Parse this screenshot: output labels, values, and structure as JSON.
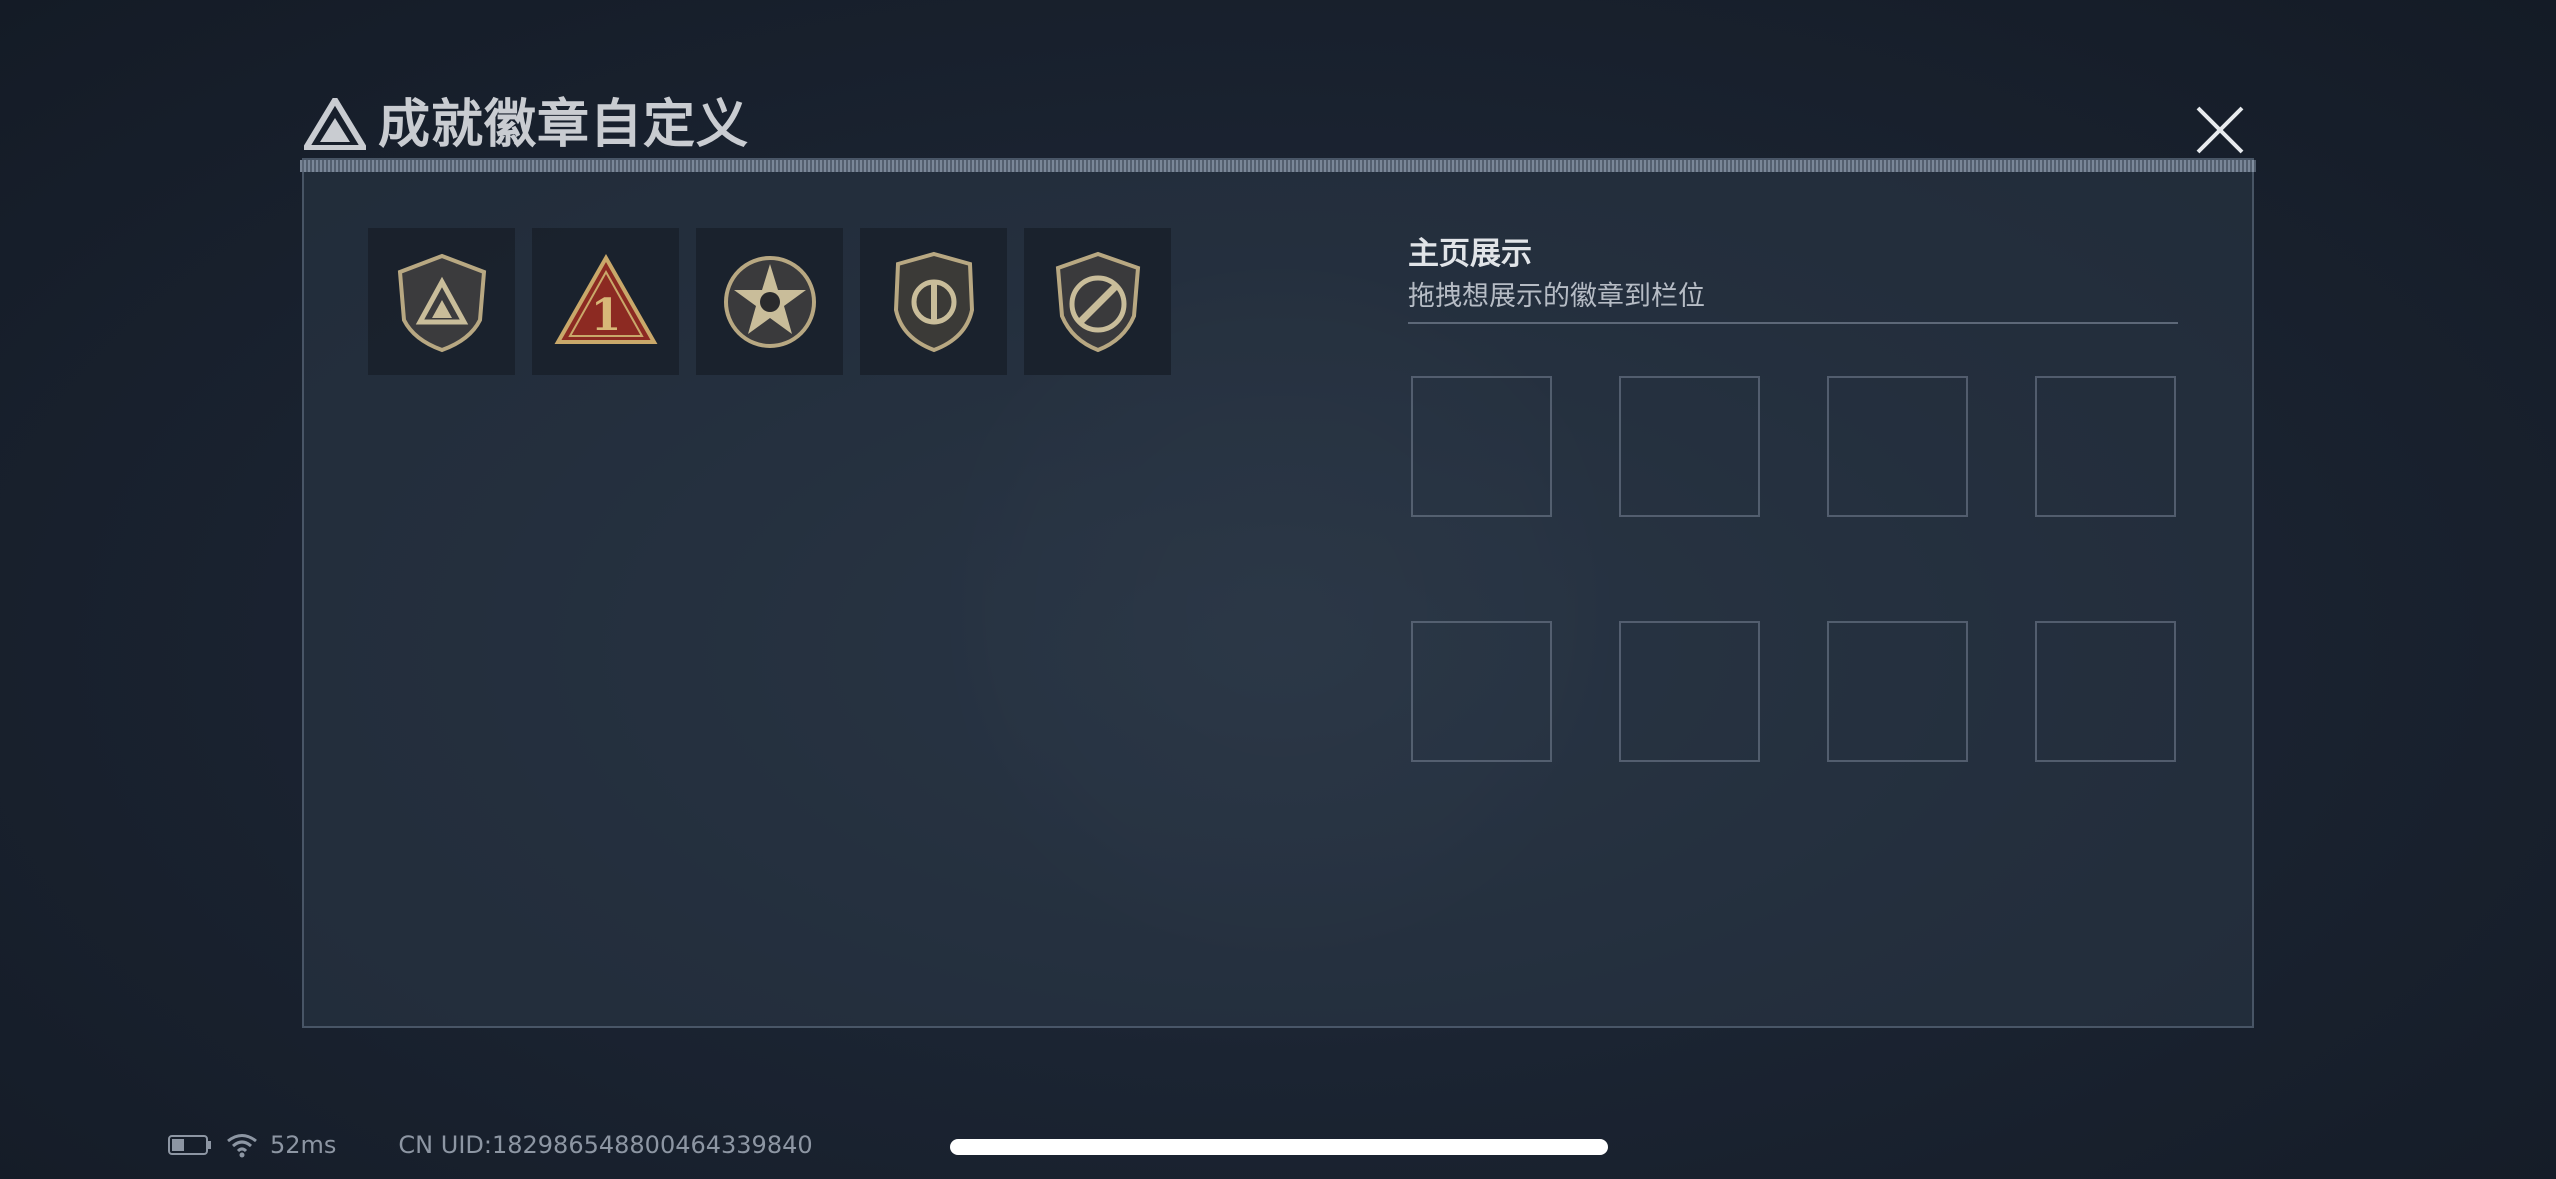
{
  "header": {
    "title": "成就徽章自定义",
    "logo_icon": "triangle-emblem-icon",
    "close_icon": "close-icon"
  },
  "badges": [
    {
      "name": "shield-triangle-badge",
      "selected": false
    },
    {
      "name": "triangle-number-one-badge",
      "label": "1"
    },
    {
      "name": "star-skull-badge"
    },
    {
      "name": "shield-dial-badge"
    },
    {
      "name": "knife-ring-badge"
    }
  ],
  "showcase": {
    "title": "主页展示",
    "hint": "拖拽想展示的徽章到栏位",
    "slot_count": 8
  },
  "status": {
    "ping": "52ms",
    "uid": "CN UID:182986548800464339840"
  },
  "colors": {
    "background": "#1b2432",
    "badge_gold": "#b8a882",
    "badge_red": "#8c2a22",
    "title_text": "#c9ccd1"
  }
}
